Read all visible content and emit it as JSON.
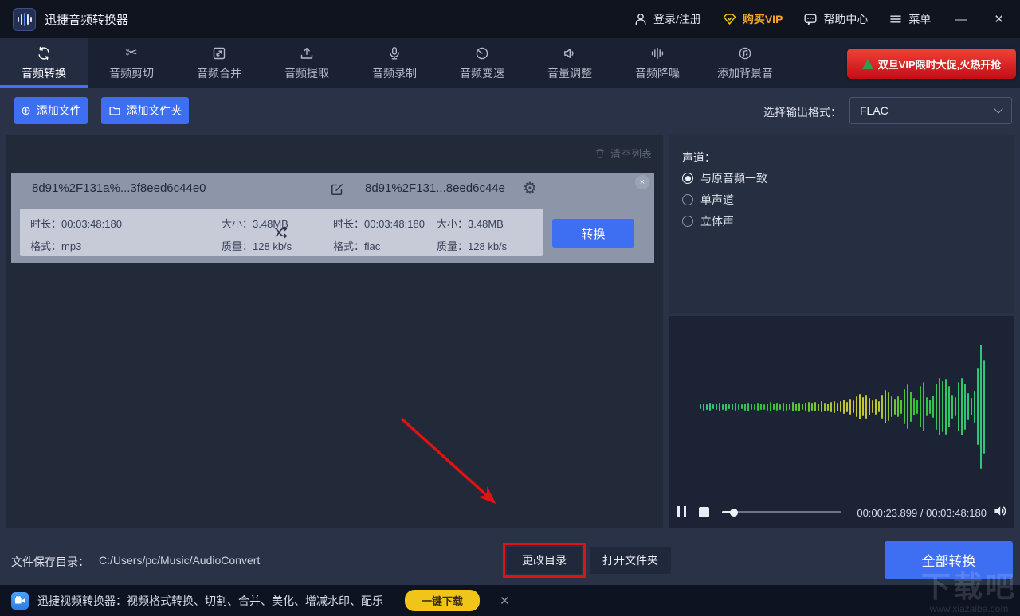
{
  "titlebar": {
    "app_title": "迅捷音频转换器",
    "login": "登录/注册",
    "buy_vip": "购买VIP",
    "help_center": "帮助中心",
    "menu": "菜单",
    "minimize": "—",
    "close": "✕"
  },
  "tabs": [
    {
      "label": "音频转换",
      "active": true
    },
    {
      "label": "音频剪切",
      "active": false
    },
    {
      "label": "音频合并",
      "active": false
    },
    {
      "label": "音频提取",
      "active": false
    },
    {
      "label": "音频录制",
      "active": false
    },
    {
      "label": "音频变速",
      "active": false
    },
    {
      "label": "音量调整",
      "active": false
    },
    {
      "label": "音频降噪",
      "active": false
    },
    {
      "label": "添加背景音",
      "active": false
    }
  ],
  "promo": {
    "label": "双旦VIP限时大促,火热开抢"
  },
  "toolbar": {
    "add_file": "添加文件",
    "add_folder": "添加文件夹",
    "output_format_label": "选择输出格式：",
    "output_format_value": "FLAC"
  },
  "icons": {
    "scissors": "✂",
    "gear": "⚙",
    "add_plus": "⊕"
  },
  "file_list": {
    "clear_label": "清空列表",
    "item": {
      "source_name": "8d91%2F131a%...3f8eed6c44e0",
      "target_name": "8d91%2F131...8eed6c44e",
      "labels": {
        "duration": "时长：",
        "size": "大小：",
        "format": "格式：",
        "quality": "质量："
      },
      "source": {
        "duration": "00:03:48:180",
        "size": "3.48MB",
        "format": "mp3",
        "quality": "128 kb/s"
      },
      "target": {
        "duration": "00:03:48:180",
        "size": "3.48MB",
        "format": "flac",
        "quality": "128 kb/s"
      },
      "convert_label": "转换",
      "remove_label": "×"
    }
  },
  "channel": {
    "title": "声道：",
    "options": [
      {
        "label": "与原音频一致",
        "selected": true
      },
      {
        "label": "单声道",
        "selected": false
      },
      {
        "label": "立体声",
        "selected": false
      }
    ]
  },
  "player": {
    "time": "00:00:23.899 / 00:03:48:180",
    "progress_percent": 10
  },
  "waveform": {
    "heights": [
      6,
      9,
      7,
      10,
      6,
      8,
      11,
      7,
      9,
      6,
      8,
      10,
      7,
      6,
      9,
      11,
      8,
      7,
      10,
      8,
      7,
      9,
      12,
      8,
      10,
      7,
      11,
      9,
      8,
      12,
      9,
      11,
      8,
      10,
      13,
      10,
      12,
      9,
      14,
      11,
      9,
      13,
      15,
      11,
      14,
      18,
      13,
      20,
      16,
      26,
      32,
      24,
      30,
      22,
      16,
      20,
      14,
      30,
      42,
      36,
      26,
      20,
      26,
      18,
      44,
      56,
      38,
      22,
      18,
      52,
      62,
      24,
      18,
      28,
      58,
      72,
      64,
      70,
      52,
      30,
      24,
      62,
      72,
      58,
      34,
      22,
      40,
      96,
      156,
      118
    ],
    "hue_stops": [
      [
        0,
        158
      ],
      [
        0.38,
        95
      ],
      [
        0.5,
        58
      ],
      [
        0.62,
        62
      ],
      [
        0.72,
        110
      ],
      [
        0.85,
        140
      ],
      [
        1,
        150
      ]
    ]
  },
  "output": {
    "save_dir_label": "文件保存目录：",
    "save_dir_value": "C:/Users/pc/Music/AudioConvert",
    "change_dir": "更改目录",
    "open_folder": "打开文件夹",
    "convert_all": "全部转换"
  },
  "banner": {
    "text": "迅捷视频转换器：视频格式转换、切割、合并、美化、增减水印、配乐",
    "download": "一键下载",
    "close": "✕"
  },
  "watermark": {
    "title": "下载吧",
    "url": "www.xiazaiba.com"
  }
}
